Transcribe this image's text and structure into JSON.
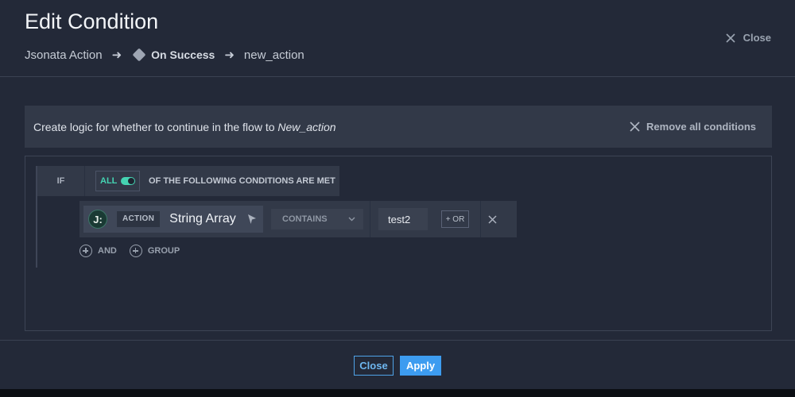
{
  "header": {
    "title": "Edit Condition",
    "close_label": "Close",
    "breadcrumb": [
      "Jsonata Action",
      "On Success",
      "new_action"
    ]
  },
  "info_bar": {
    "text_prefix": "Create logic for whether to continue in the flow to ",
    "target": "New_action",
    "remove_all_label": "Remove all conditions"
  },
  "group": {
    "if_label": "IF",
    "match_mode": "ALL",
    "match_description": "OF THE FOLLOWING CONDITIONS ARE MET"
  },
  "condition": {
    "logo_glyph": "J:",
    "source_badge": "ACTION",
    "field_name": "String Array",
    "operator": "CONTAINS",
    "value": "test2",
    "or_label": "+ OR"
  },
  "add_controls": {
    "and_label": "AND",
    "group_label": "GROUP"
  },
  "footer": {
    "close_label": "Close",
    "apply_label": "Apply"
  },
  "colors": {
    "accent_blue": "#3d9cf0",
    "toggle_green": "#45d3b2",
    "panel": "#323948",
    "background": "#232938"
  }
}
